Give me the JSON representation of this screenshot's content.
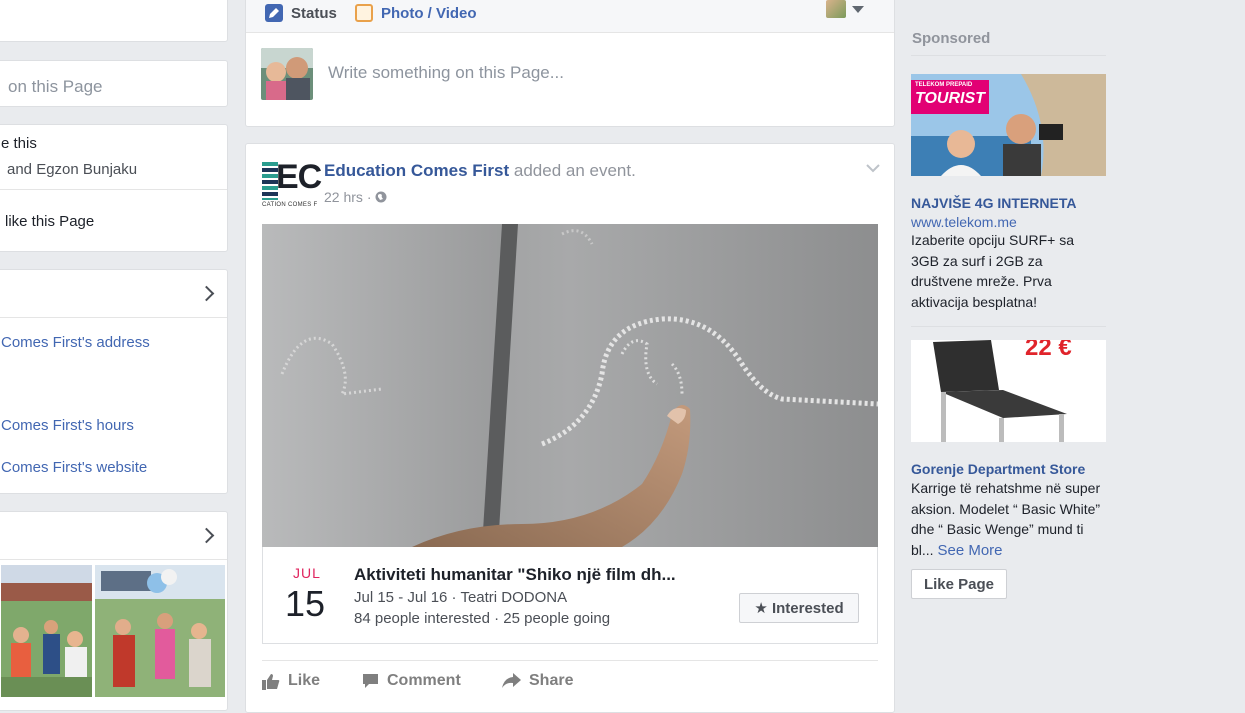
{
  "left_column": {
    "page_search_placeholder": "on this Page",
    "likes_line1": "e this",
    "likes_line2": "and Egzon Bunjaku",
    "likes_line3": "like this Page",
    "about_address": "Comes First's address",
    "about_hours": "Comes First's hours",
    "about_website": "Comes First's website"
  },
  "composer": {
    "status_tab": "Status",
    "photo_tab": "Photo / Video",
    "placeholder": "Write something on this Page..."
  },
  "post": {
    "page_name": "Education Comes First",
    "action_text": "added an event.",
    "time": "22 hrs",
    "logo_letters": "EC",
    "logo_caption": "CATION COMES F",
    "event": {
      "month": "JUL",
      "day": "15",
      "title": "Aktiviteti humanitar \"Shiko një film dh...",
      "dates_place": "Jul 15 - Jul 16 · Teatri DODONA",
      "stats": "84 people interested · 25 people going",
      "interested_label": "★ Interested"
    },
    "actions": {
      "like": "Like",
      "comment": "Comment",
      "share": "Share"
    }
  },
  "sponsored": {
    "heading": "Sponsored",
    "ad1": {
      "banner_line1": "TELEKOM PREPAID",
      "banner_line2": "TOURIST",
      "title": "NAJVIŠE 4G INTERNETA",
      "url": "www.telekom.me",
      "body": "Izaberite opciju SURF+ sa 3GB za surf i 2GB za društvene mreže. Prva aktivacija besplatna!"
    },
    "ad2": {
      "price": "22 €",
      "title": "Gorenje Department Store",
      "body": "Karrige të rehatshme në super aksion. Modelet “ Basic White” dhe “ Basic Wenge” mund ti bl...",
      "see_more": "See More",
      "like_page": "Like Page"
    }
  },
  "colors": {
    "background": "#e9ebee",
    "link": "#4267b2",
    "name": "#365899",
    "month_red": "#e0245e"
  }
}
